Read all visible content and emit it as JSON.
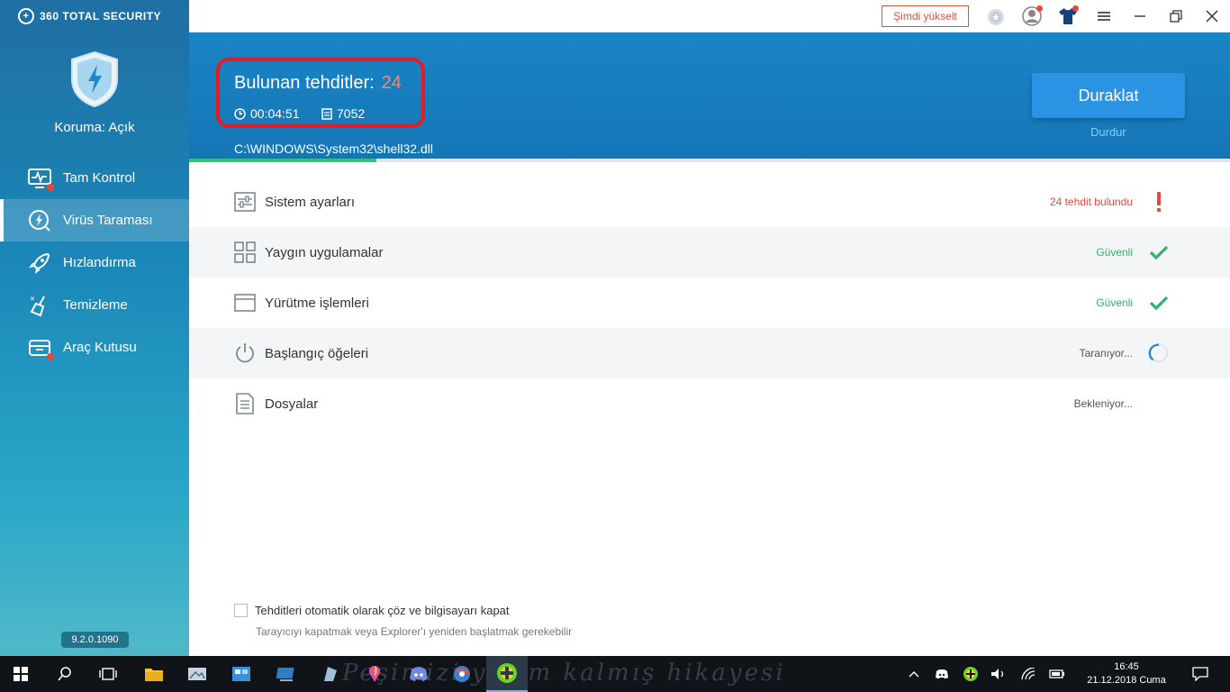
{
  "app": {
    "brand": "360 TOTAL SECURITY",
    "protection_status": "Koruma: Açık",
    "version": "9.2.0.1090"
  },
  "sidebar": {
    "items": [
      {
        "label": "Tam Kontrol",
        "icon": "monitor-pulse-icon",
        "badge": true
      },
      {
        "label": "Virüs Taraması",
        "icon": "bolt-circle-icon",
        "active": true
      },
      {
        "label": "Hızlandırma",
        "icon": "rocket-icon"
      },
      {
        "label": "Temizleme",
        "icon": "broom-icon"
      },
      {
        "label": "Araç Kutusu",
        "icon": "toolbox-icon",
        "badge": true
      }
    ]
  },
  "topbar": {
    "upgrade_label": "Şimdi yükselt"
  },
  "scan": {
    "threats_label": "Bulunan tehditler:",
    "threats_count": "24",
    "elapsed": "00:04:51",
    "files_scanned": "7052",
    "current_path": "C:\\WINDOWS\\System32\\shell32.dll",
    "progress": 0.18,
    "pause_label": "Duraklat",
    "stop_label": "Durdur"
  },
  "scan_items": [
    {
      "label": "Sistem ayarları",
      "status": "24 tehdit bulundu",
      "state": "danger",
      "icon": "sliders-icon"
    },
    {
      "label": "Yaygın uygulamalar",
      "status": "Güvenli",
      "state": "safe",
      "icon": "grid-icon"
    },
    {
      "label": "Yürütme işlemleri",
      "status": "Güvenli",
      "state": "safe",
      "icon": "window-icon"
    },
    {
      "label": "Başlangıç öğeleri",
      "status": "Taranıyor...",
      "state": "scanning",
      "icon": "power-icon"
    },
    {
      "label": "Dosyalar",
      "status": "Bekleniyor...",
      "state": "waiting",
      "icon": "document-icon"
    }
  ],
  "options": {
    "auto_fix_label": "Tehditleri otomatik olarak çöz ve bilgisayarı kapat",
    "auto_fix_note": "Tarayıcıyı kapatmak veya Explorer'ı yeniden başlatmak gerekebilir",
    "auto_fix_checked": false
  },
  "taskbar": {
    "time": "16:45",
    "date": "21.12.2018 Cuma",
    "watermark": "Peşimizi yarım kalmış hikayesi"
  },
  "colors": {
    "header_blue": "#1a84c5",
    "threat_red": "#e51b24",
    "safe_green": "#2ab66b",
    "danger_red": "#e9463c",
    "button_blue": "#2b93e4"
  }
}
